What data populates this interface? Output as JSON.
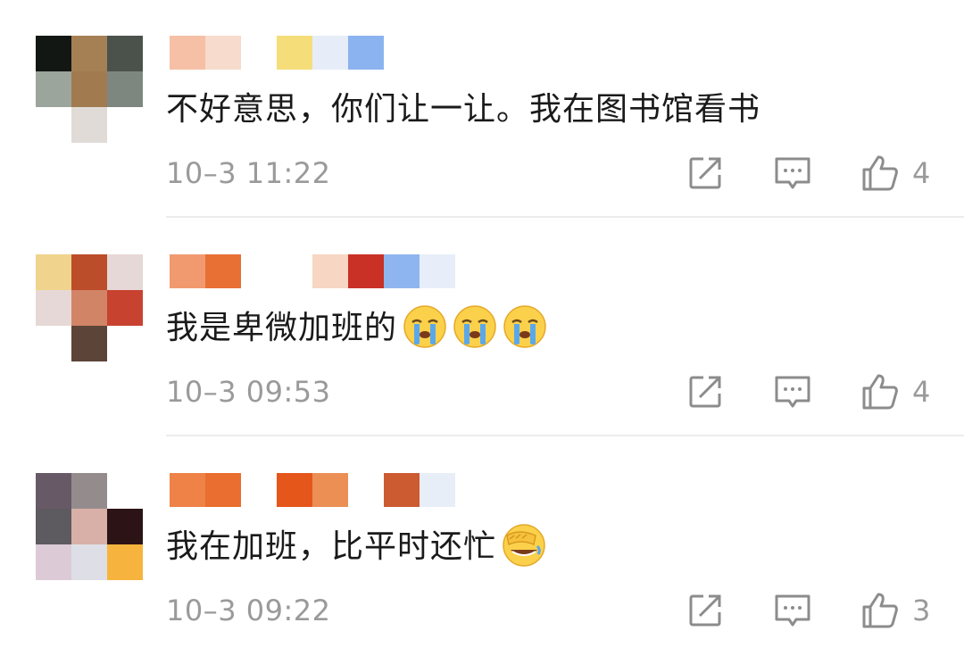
{
  "comments": [
    {
      "text": "不好意思，你们让一让。我在图书馆看书",
      "time": "10–3 11:22",
      "likes": "4",
      "emojis": [],
      "avatar_colors": [
        "#121714",
        "#a68055",
        "#4b524c",
        "#9ca59c",
        "#a27a4f",
        "#7d8780",
        "#ffffff",
        "#e1dbd8",
        "#ffffff"
      ],
      "name_blocks": [
        {
          "color": "#f5c0a6",
          "w": 40
        },
        {
          "color": "#f7dbcc",
          "w": 40
        },
        {
          "color": "#f5dd7a",
          "w": 40
        },
        {
          "color": "#e6edf8",
          "w": 40
        },
        {
          "color": "#8bb3ef",
          "w": 40
        }
      ]
    },
    {
      "text": "我是卑微加班的",
      "time": "10–3 09:53",
      "likes": "4",
      "emojis": [
        "crying-emoji",
        "crying-emoji",
        "crying-emoji"
      ],
      "avatar_colors": [
        "#f0d38c",
        "#bc4d2a",
        "#e6d8d6",
        "#e6d8d6",
        "#d28467",
        "#c84230",
        "#ffffff",
        "#5c4438",
        "#ffffff"
      ],
      "name_blocks": [
        {
          "color": "#f19a6f",
          "w": 40
        },
        {
          "color": "#e87035",
          "w": 40
        },
        {
          "color": "#f7d6c3",
          "w": 40
        },
        {
          "color": "#c93126",
          "w": 40
        },
        {
          "color": "#8eb5f0",
          "w": 40
        },
        {
          "color": "#e7eef9",
          "w": 40
        }
      ]
    },
    {
      "text": "我在加班，比平时还忙",
      "time": "10–3 09:22",
      "likes": "3",
      "emojis": [
        "facepalm-laugh-emoji"
      ],
      "avatar_colors": [
        "#675a66",
        "#948b8d",
        "#ffffff",
        "#5d5a60",
        "#d8b0a7",
        "#2c1416",
        "#dccad7",
        "#dedfe6",
        "#f6b43e"
      ],
      "name_blocks": [
        {
          "color": "#ee8247",
          "w": 40
        },
        {
          "color": "#e96e2f",
          "w": 40
        },
        {
          "color": "#e5561b",
          "w": 40
        },
        {
          "color": "#ec8f55",
          "w": 40
        },
        {
          "color": "#cc5b31",
          "w": 40
        },
        {
          "color": "#e8eef8",
          "w": 40
        }
      ]
    }
  ],
  "icons": {
    "share": "share-icon",
    "reply": "comment-icon",
    "like": "thumbs-up-icon"
  }
}
